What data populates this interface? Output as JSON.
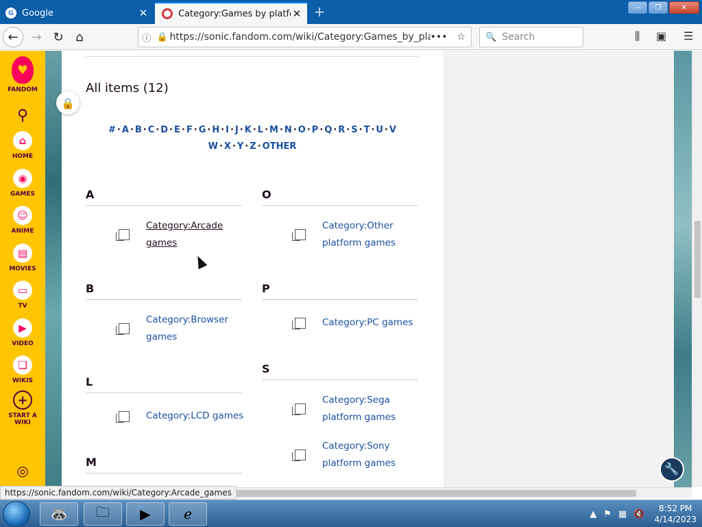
{
  "browser": {
    "tabs": [
      {
        "title": "Google",
        "icon": "google-favicon"
      },
      {
        "title": "Category:Games by platform | Sonic",
        "icon": "sonic-favicon"
      }
    ],
    "url_prefix": "https://sonic.",
    "url_domain": "fandom.com",
    "url_path": "/wiki/Category:Games_by_platfo",
    "search_placeholder": "Search",
    "status_url": "https://sonic.fandom.com/wiki/Category:Arcade_games"
  },
  "rail": {
    "brand": "FANDOM",
    "items": [
      {
        "label": "HOME",
        "icon": "home-icon"
      },
      {
        "label": "GAMES",
        "icon": "gamepad-icon"
      },
      {
        "label": "ANIME",
        "icon": "anime-icon"
      },
      {
        "label": "MOVIES",
        "icon": "movie-icon"
      },
      {
        "label": "TV",
        "icon": "tv-icon"
      },
      {
        "label": "VIDEO",
        "icon": "video-icon"
      },
      {
        "label": "WIKIS",
        "icon": "book-icon"
      }
    ],
    "start_wiki": [
      "START A",
      "WIKI"
    ]
  },
  "page": {
    "all_items": "All items (12)",
    "alpha_row1": [
      "#",
      "A",
      "B",
      "C",
      "D",
      "E",
      "F",
      "G",
      "H",
      "I",
      "J",
      "K",
      "L",
      "M",
      "N",
      "O",
      "P",
      "Q",
      "R",
      "S",
      "T",
      "U",
      "V"
    ],
    "alpha_row2": [
      "W",
      "X",
      "Y",
      "Z",
      "OTHER"
    ],
    "groups": {
      "A": {
        "letter": "A",
        "items": [
          [
            "Category:Arcade",
            "games"
          ]
        ]
      },
      "B": {
        "letter": "B",
        "items": [
          [
            "Category:Browser",
            "games"
          ]
        ]
      },
      "L": {
        "letter": "L",
        "items": [
          [
            "Category:LCD games"
          ]
        ]
      },
      "M": {
        "letter": "M"
      },
      "O": {
        "letter": "O",
        "items": [
          [
            "Category:Other",
            "platform games"
          ]
        ]
      },
      "P": {
        "letter": "P",
        "items": [
          [
            "Category:PC games"
          ]
        ]
      },
      "S": {
        "letter": "S",
        "items": [
          [
            "Category:Sega",
            "platform games"
          ],
          [
            "Category:Sony",
            "platform games"
          ]
        ]
      }
    }
  },
  "taskbar": {
    "time": "8:52 PM",
    "date": "4/14/2023"
  },
  "colors": {
    "fandom_yellow": "#ffc500",
    "fandom_pink": "#fa005a",
    "link_blue": "#1a4fa0"
  }
}
